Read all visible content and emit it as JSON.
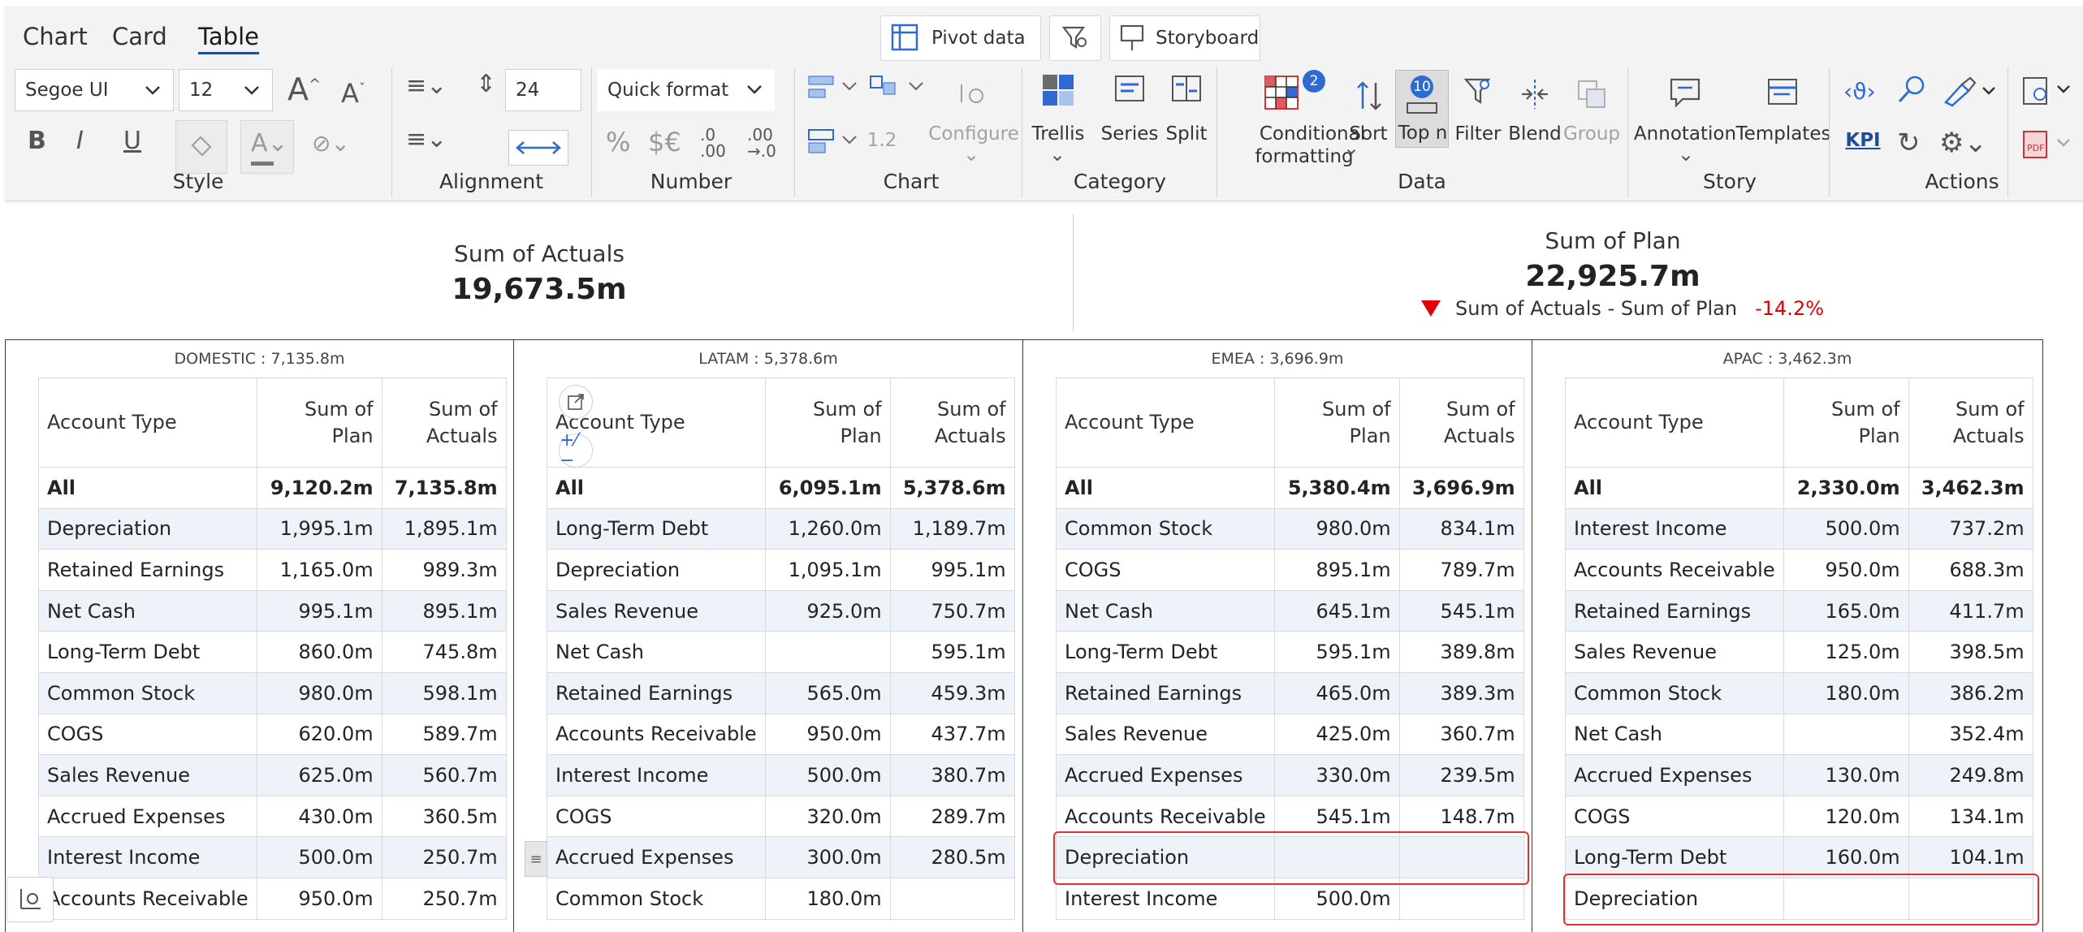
{
  "tabs": [
    "Chart",
    "Card",
    "Table"
  ],
  "active_tab": "Table",
  "top_buttons": {
    "pivot": "Pivot data",
    "storyboard": "Storyboard"
  },
  "style": {
    "font": "Segoe UI",
    "size": "12",
    "label": "Style",
    "bold": "B",
    "italic": "I",
    "underline": "U"
  },
  "alignment": {
    "height_value": "24",
    "label": "Alignment"
  },
  "number": {
    "quick_format": "Quick format",
    "percent": "%",
    "currency": "$€",
    "dec_inc": ".0\n.00",
    "dec_dec": ".00\n→.0",
    "label": "Number"
  },
  "chart": {
    "scale": "1.2",
    "configure": "Configure",
    "label": "Chart"
  },
  "category": {
    "trellis": "Trellis",
    "series": "Series",
    "split": "Split",
    "label": "Category"
  },
  "data": {
    "conditional_formatting": "Conditional",
    "conditional_formatting2": "formatting",
    "cf_badge": "2",
    "sort": "Sort",
    "topn": "Top n",
    "topn_badge": "10",
    "filter": "Filter",
    "blend": "Blend",
    "group": "Group",
    "label": "Data"
  },
  "story": {
    "annotation": "Annotation",
    "templates": "Templates",
    "label": "Story"
  },
  "actions": {
    "kpi": "KPI",
    "label": "Actions"
  },
  "kpis": {
    "actuals_label": "Sum of Actuals",
    "actuals_value": "19,673.5m",
    "plan_label": "Sum of Plan",
    "plan_value": "22,925.7m",
    "variance_label": "Sum of Actuals - Sum of Plan",
    "variance_value": "-14.2%"
  },
  "colors": {
    "accent": "#1f4e99",
    "badge": "#2f6ad0",
    "negative": "#e00000",
    "highlight": "#e23030",
    "row_alt": "#eef3f9"
  },
  "table_headers": {
    "account_type": "Account Type",
    "plan1": "Sum of",
    "plan2": "Plan",
    "actuals1": "Sum of",
    "actuals2": "Actuals"
  },
  "panels": [
    {
      "title": "DOMESTIC :  7,135.8m",
      "rows": [
        [
          "All",
          "9,120.2m",
          "7,135.8m"
        ],
        [
          "Depreciation",
          "1,995.1m",
          "1,895.1m"
        ],
        [
          "Retained Earnings",
          "1,165.0m",
          "989.3m"
        ],
        [
          "Net Cash",
          "995.1m",
          "895.1m"
        ],
        [
          "Long-Term Debt",
          "860.0m",
          "745.8m"
        ],
        [
          "Common Stock",
          "980.0m",
          "598.1m"
        ],
        [
          "COGS",
          "620.0m",
          "589.7m"
        ],
        [
          "Sales Revenue",
          "625.0m",
          "560.7m"
        ],
        [
          "Accrued Expenses",
          "430.0m",
          "360.5m"
        ],
        [
          "Interest Income",
          "500.0m",
          "250.7m"
        ],
        [
          "Accounts Receivable",
          "950.0m",
          "250.7m"
        ]
      ]
    },
    {
      "title": "LATAM :  5,378.6m",
      "rows": [
        [
          "All",
          "6,095.1m",
          "5,378.6m"
        ],
        [
          "Long-Term Debt",
          "1,260.0m",
          "1,189.7m"
        ],
        [
          "Depreciation",
          "1,095.1m",
          "995.1m"
        ],
        [
          "Sales Revenue",
          "925.0m",
          "750.7m"
        ],
        [
          "Net Cash",
          "",
          "595.1m"
        ],
        [
          "Retained Earnings",
          "565.0m",
          "459.3m"
        ],
        [
          "Accounts Receivable",
          "950.0m",
          "437.7m"
        ],
        [
          "Interest Income",
          "500.0m",
          "380.7m"
        ],
        [
          "COGS",
          "320.0m",
          "289.7m"
        ],
        [
          "Accrued Expenses",
          "300.0m",
          "280.5m"
        ],
        [
          "Common Stock",
          "180.0m",
          ""
        ]
      ]
    },
    {
      "title": "EMEA :  3,696.9m",
      "rows": [
        [
          "All",
          "5,380.4m",
          "3,696.9m"
        ],
        [
          "Common Stock",
          "980.0m",
          "834.1m"
        ],
        [
          "COGS",
          "895.1m",
          "789.7m"
        ],
        [
          "Net Cash",
          "645.1m",
          "545.1m"
        ],
        [
          "Long-Term Debt",
          "595.1m",
          "389.8m"
        ],
        [
          "Retained Earnings",
          "465.0m",
          "389.3m"
        ],
        [
          "Sales Revenue",
          "425.0m",
          "360.7m"
        ],
        [
          "Accrued Expenses",
          "330.0m",
          "239.5m"
        ],
        [
          "Accounts Receivable",
          "545.1m",
          "148.7m"
        ],
        [
          "Depreciation",
          "",
          ""
        ],
        [
          "Interest Income",
          "500.0m",
          ""
        ]
      ]
    },
    {
      "title": "APAC :  3,462.3m",
      "rows": [
        [
          "All",
          "2,330.0m",
          "3,462.3m"
        ],
        [
          "Interest Income",
          "500.0m",
          "737.2m"
        ],
        [
          "Accounts Receivable",
          "950.0m",
          "688.3m"
        ],
        [
          "Retained Earnings",
          "165.0m",
          "411.7m"
        ],
        [
          "Sales Revenue",
          "125.0m",
          "398.5m"
        ],
        [
          "Common Stock",
          "180.0m",
          "386.2m"
        ],
        [
          "Net Cash",
          "",
          "352.4m"
        ],
        [
          "Accrued Expenses",
          "130.0m",
          "249.8m"
        ],
        [
          "COGS",
          "120.0m",
          "134.1m"
        ],
        [
          "Long-Term Debt",
          "160.0m",
          "104.1m"
        ],
        [
          "Depreciation",
          "",
          ""
        ]
      ]
    }
  ]
}
